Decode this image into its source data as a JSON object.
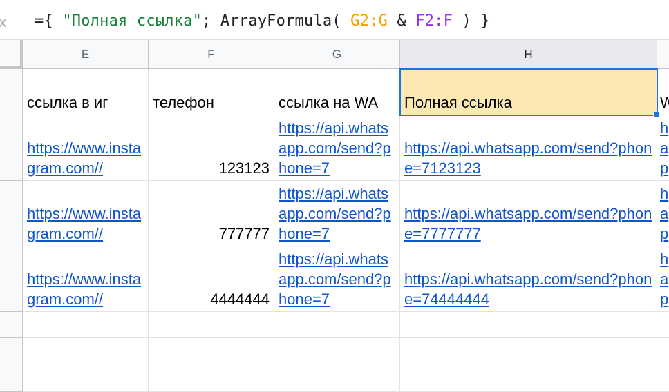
{
  "formula_bar": {
    "fx_glyph": "x",
    "formula_open": "={ ",
    "formula_string": "\"Полная ссылка\"",
    "formula_mid": "; ArrayFormula( ",
    "formula_ref1": "G2:G",
    "formula_amp": " & ",
    "formula_ref2": "F2:F",
    "formula_close": " ) }",
    "colors": {
      "string": "#188038",
      "ref1": "#f4a000",
      "ref2": "#9334e6",
      "text": "#202124"
    }
  },
  "columns": [
    "E",
    "F",
    "G",
    "H"
  ],
  "selected_column": "H",
  "header_row": {
    "E": "ссылка в иг",
    "F": "телефон",
    "G": "ссылка на WA",
    "H": "Полная ссылка",
    "I": "W"
  },
  "rows": [
    {
      "E": "https://www.instagram.com//",
      "F": "123123",
      "G": "https://api.whatsapp.com/send?phone=7",
      "H": "https://api.whatsapp.com/send?phone=7123123",
      "I": "h a p"
    },
    {
      "E": "https://www.instagram.com//",
      "F": "777777",
      "G": "https://api.whatsapp.com/send?phone=7",
      "H": "https://api.whatsapp.com/send?phone=7777777",
      "I": "h a p"
    },
    {
      "E": "https://www.instagram.com//",
      "F": "4444444",
      "G": "https://api.whatsapp.com/send?phone=7",
      "H": "https://api.whatsapp.com/send?phone=74444444",
      "I": "h a p"
    }
  ],
  "highlight_color": "#fce8b2",
  "selection_color": "#1a73e8",
  "link_color": "#1155cc"
}
